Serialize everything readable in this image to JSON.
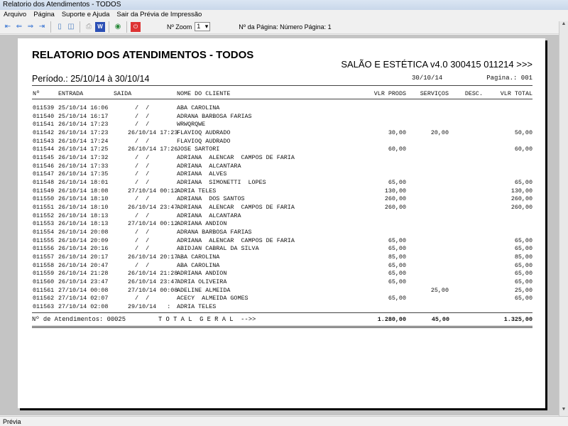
{
  "window_title": "Relatorio dos Atendimentos - TODOS",
  "menu": [
    "Arquivo",
    "Página",
    "Suporte e Ajuda",
    "Sair da Prévia de Impressão"
  ],
  "toolbar": {
    "zoom_label": "Nº Zoom",
    "zoom_value": "1",
    "page_label": "Nº da Página: Número Página: 1"
  },
  "report": {
    "title": "RELATORIO DOS ATENDIMENTOS - TODOS",
    "system": "SALÃO E ESTÉTICA v4.0 300415 011214 >>>",
    "period": "Período.: 25/10/14 à 30/10/14",
    "date": "30/10/14",
    "page": "Pagina.: 001",
    "columns": [
      "Nº",
      "ENTRADA",
      "SAIDA",
      "NOME DO CLIENTE",
      "VLR PRODS",
      "SERVIÇOS",
      "DESC.",
      "VLR TOTAL"
    ],
    "rows": [
      [
        "011539",
        "25/10/14 16:06",
        "  /  /",
        "ABA CAROLINA",
        "",
        "",
        "",
        ""
      ],
      [
        "011540",
        "25/10/14 16:17",
        "  /  /",
        "ADRANA BARBOSA FARIAS",
        "",
        "",
        "",
        ""
      ],
      [
        "011541",
        "26/10/14 17:23",
        "  /  /",
        "WRWQRQWE",
        "",
        "",
        "",
        ""
      ],
      [
        "011542",
        "26/10/14 17:23",
        "26/10/14 17:23",
        "FLAVIOQ AUDRADO",
        "30,00",
        "20,00",
        "",
        "50,00"
      ],
      [
        "011543",
        "26/10/14 17:24",
        "  /  /",
        "FLAVIOQ AUDRADO",
        "",
        "",
        "",
        ""
      ],
      [
        "011544",
        "26/10/14 17:25",
        "26/10/14 17:26",
        "JOSE SARTORI",
        "60,00",
        "",
        "",
        "60,00"
      ],
      [
        "011545",
        "26/10/14 17:32",
        "  /  /",
        "ADRIANA  ALENCAR  CAMPOS DE FARIA",
        "",
        "",
        "",
        ""
      ],
      [
        "011546",
        "26/10/14 17:33",
        "  /  /",
        "ADRIANA  ALCANTARA",
        "",
        "",
        "",
        ""
      ],
      [
        "011547",
        "26/10/14 17:35",
        "  /  /",
        "ADRIANA  ALVES",
        "",
        "",
        "",
        ""
      ],
      [
        "011548",
        "26/10/14 18:01",
        "  /  /",
        "ADRIANA  SIMONETTI  LOPES",
        "65,00",
        "",
        "",
        "65,00"
      ],
      [
        "011549",
        "26/10/14 18:08",
        "27/10/14 00:12",
        "ADRIA TELES",
        "130,00",
        "",
        "",
        "130,00"
      ],
      [
        "011550",
        "26/10/14 18:10",
        "  /  /",
        "ADRIANA  DOS SANTOS",
        "260,00",
        "",
        "",
        "260,00"
      ],
      [
        "011551",
        "26/10/14 18:10",
        "26/10/14 23:47",
        "ADRIANA  ALENCAR  CAMPOS DE FARIA",
        "260,00",
        "",
        "",
        "260,00"
      ],
      [
        "011552",
        "26/10/14 18:13",
        "  /  /",
        "ADRIANA  ALCANTARA",
        "",
        "",
        "",
        ""
      ],
      [
        "011553",
        "26/10/14 18:13",
        "27/10/14 00:12",
        "ADRIANA ANDION",
        "",
        "",
        "",
        ""
      ],
      [
        "011554",
        "26/10/14 20:08",
        "  /  /",
        "ADRANA BARBOSA FARIAS",
        "",
        "",
        "",
        ""
      ],
      [
        "011555",
        "26/10/14 20:09",
        "  /  /",
        "ADRIANA  ALENCAR  CAMPOS DE FARIA",
        "65,00",
        "",
        "",
        "65,00"
      ],
      [
        "011556",
        "26/10/14 20:16",
        "  /  /",
        "ABIDJAN CABRAL DA SILVA",
        "65,00",
        "",
        "",
        "65,00"
      ],
      [
        "011557",
        "26/10/14 20:17",
        "26/10/14 20:17",
        "ABA CAROLINA",
        "85,00",
        "",
        "",
        "85,00"
      ],
      [
        "011558",
        "26/10/14 20:47",
        "  /  /",
        "ABA CAROLINA",
        "65,00",
        "",
        "",
        "65,00"
      ],
      [
        "011559",
        "26/10/14 21:28",
        "26/10/14 21:28",
        "ADRIANA ANDION",
        "65,00",
        "",
        "",
        "65,00"
      ],
      [
        "011560",
        "26/10/14 23:47",
        "26/10/14 23:47",
        "ADRIA OLIVEIRA",
        "65,00",
        "",
        "",
        "65,00"
      ],
      [
        "011561",
        "27/10/14 00:08",
        "27/10/14 00:08",
        "ADELINE ALMEIDA",
        "",
        "25,00",
        "",
        "25,00"
      ],
      [
        "011562",
        "27/10/14 02:07",
        "  /  /",
        "ACECY  ALMEIDA GOMES",
        "65,00",
        "",
        "",
        "65,00"
      ],
      [
        "011563",
        "27/10/14 02:08",
        "29/10/14   :",
        "ADRIA TELES",
        "",
        "",
        "",
        ""
      ]
    ],
    "footer": {
      "count": "Nº de Atendimentos: 00025",
      "total_label": "T O T A L  G E R A L  -->>",
      "prods": "1.280,00",
      "servicos": "45,00",
      "total": "1.325,00"
    }
  },
  "status": "Prévia"
}
